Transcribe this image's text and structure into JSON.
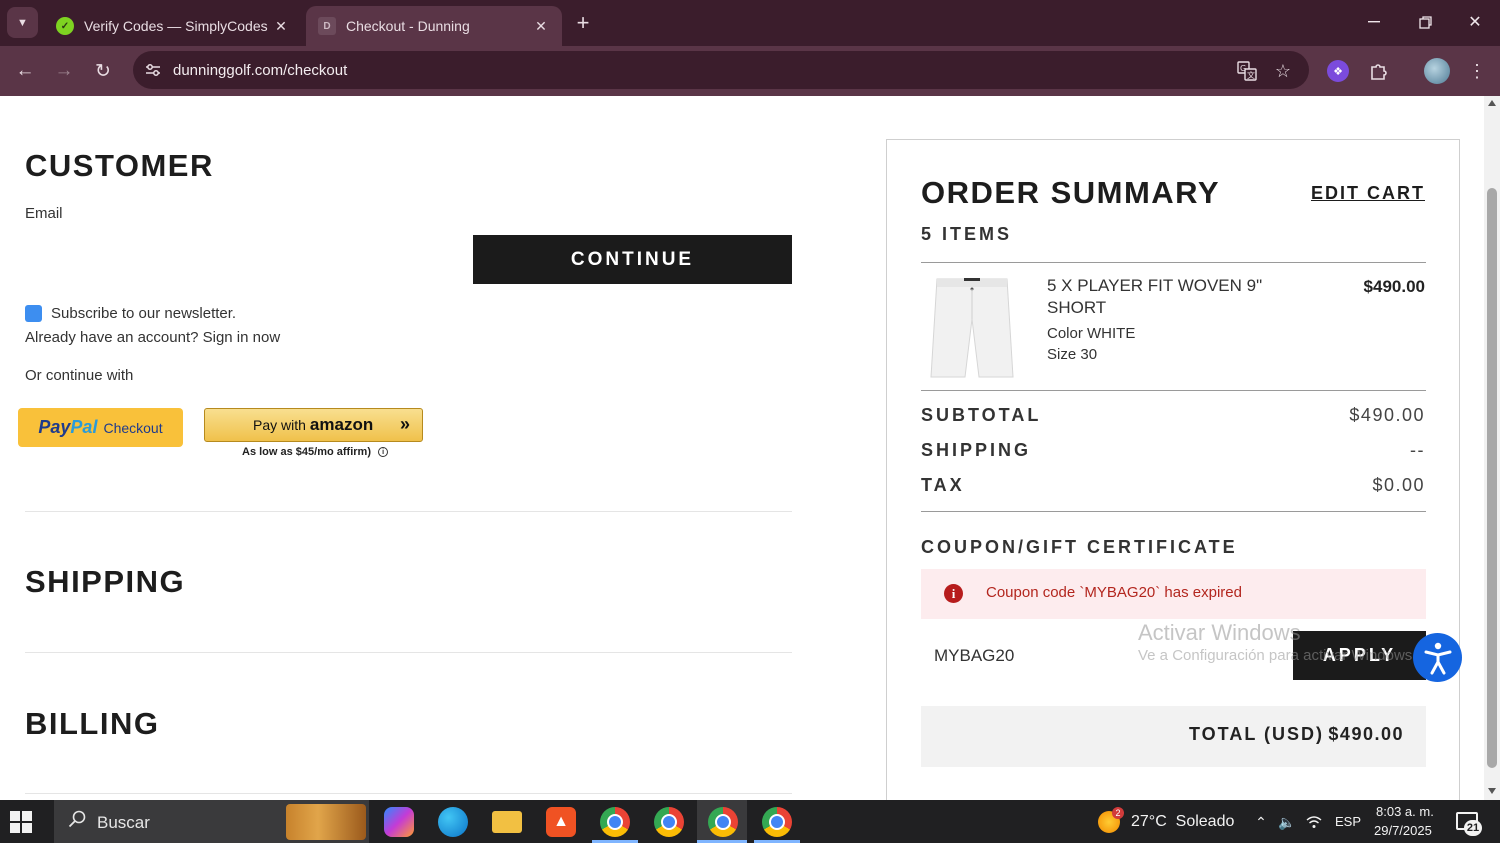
{
  "browser": {
    "tabs": [
      {
        "title": "Verify Codes — SimplyCodes",
        "active": false
      },
      {
        "title": "Checkout - Dunning",
        "active": true
      }
    ],
    "url": "dunninggolf.com/checkout",
    "icons": {
      "tab_search": "chevron-down-icon",
      "new_tab": "plus-icon",
      "back": "back-arrow-icon",
      "forward": "forward-arrow-icon",
      "reload": "reload-icon",
      "site_info": "tune-icon",
      "translate": "translate-icon",
      "bookmark": "star-icon",
      "extensions": "puzzle-icon",
      "menu": "kebab-menu-icon"
    }
  },
  "checkout": {
    "customer": {
      "heading": "CUSTOMER",
      "email_label": "Email",
      "continue_label": "CONTINUE",
      "newsletter_label": "Subscribe to our newsletter.",
      "newsletter_checked": true,
      "account_text": "Already have an account? Sign in now",
      "alt_pay_text": "Or continue with"
    },
    "paypal": {
      "brand_pay": "Pay",
      "brand_pal": "Pal",
      "label": "Checkout"
    },
    "amazon": {
      "label": "Pay with",
      "brand": "amazon"
    },
    "affirm_text": "As low as $45/mo affirm)",
    "shipping_heading": "SHIPPING",
    "billing_heading": "BILLING"
  },
  "order_summary": {
    "title": "ORDER SUMMARY",
    "edit_cart": "EDIT CART",
    "items_count": "5 ITEMS",
    "item": {
      "name": "5 X PLAYER FIT WOVEN 9\" SHORT",
      "price": "$490.00",
      "color": "Color WHITE",
      "size": "Size 30"
    },
    "subtotal_label": "SUBTOTAL",
    "subtotal_value": "$490.00",
    "shipping_label": "SHIPPING",
    "shipping_value": "--",
    "tax_label": "TAX",
    "tax_value": "$0.00",
    "coupon_title": "COUPON/GIFT CERTIFICATE",
    "coupon_error": "Coupon code `MYBAG20` has expired",
    "coupon_value": "MYBAG20",
    "apply_label": "APPLY",
    "total_label": "TOTAL (USD)",
    "total_value": "$490.00"
  },
  "watermark": {
    "line1": "Activar Windows",
    "line2": "Ve a Configuración para activar Windows."
  },
  "taskbar": {
    "search_placeholder": "Buscar",
    "weather_badge": "2",
    "weather": "27°C  Soleado",
    "lang": "ESP",
    "time": "8:03 a. m.",
    "date": "29/7/2025",
    "notifications": "21"
  }
}
